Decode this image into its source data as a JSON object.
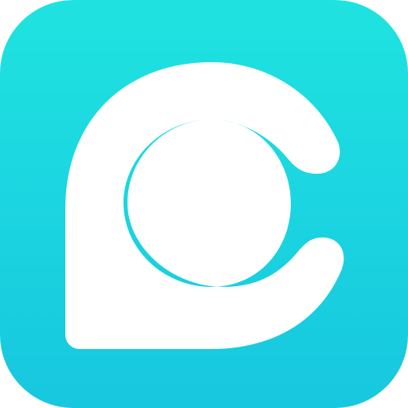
{
  "icon": {
    "name": "app-icon",
    "glyph": "letter-c-with-ring",
    "colors": {
      "gradient_top": "#1FE3E0",
      "gradient_bottom": "#17C7DF",
      "glyph": "#FFFFFF"
    }
  }
}
